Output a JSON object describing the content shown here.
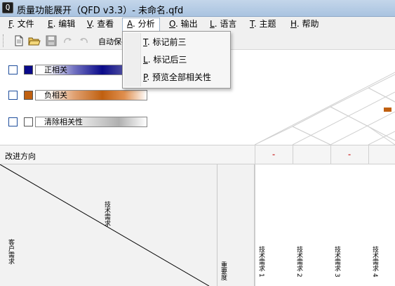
{
  "window": {
    "title": "质量功能展开（QFD  v3.3）- 未命名.qfd",
    "app_icon_glyph": "Q"
  },
  "menubar": {
    "items": [
      {
        "key": "F",
        "label": ". 文件"
      },
      {
        "key": "E",
        "label": ". 编辑"
      },
      {
        "key": "V",
        "label": ". 查看"
      },
      {
        "key": "A",
        "label": ". 分析"
      },
      {
        "key": "O",
        "label": ". 输出"
      },
      {
        "key": "L",
        "label": ". 语言"
      },
      {
        "key": "T",
        "label": ". 主题"
      },
      {
        "key": "H",
        "label": ". 帮助"
      }
    ]
  },
  "toolbar": {
    "buttons": [
      "new-document-icon",
      "open-folder-icon",
      "save-icon",
      "redo-icon",
      "undo-icon"
    ],
    "auto_save_label": "自动保存"
  },
  "analysis_menu": {
    "items": [
      {
        "key": "T",
        "label": ". 标记前三"
      },
      {
        "key": "L",
        "label": ". 标记后三"
      },
      {
        "key": "P",
        "label": ". 预览全部相关性"
      }
    ]
  },
  "legend": {
    "positive": {
      "label": "正相关",
      "color": "#0a0a8a",
      "gradient_end": "#ffffff"
    },
    "negative": {
      "label": "负相关",
      "color": "#c06010",
      "gradient_end": "#ffffff"
    },
    "clear": {
      "label": "清除相关性",
      "color": "#ffffff",
      "gradient_end": "#9a9a9a"
    }
  },
  "matrix": {
    "improvement_label": "改进方向",
    "improvement_marks": [
      "-",
      "",
      "-",
      ""
    ],
    "header_tech": "技术需求",
    "header_customer": "客户需求",
    "importance_label": "重要度",
    "tech_columns": [
      "技术需求 1",
      "技术需求 2",
      "技术需求 3",
      "技术需求 4"
    ],
    "roof_marker_color": "#c06010"
  }
}
